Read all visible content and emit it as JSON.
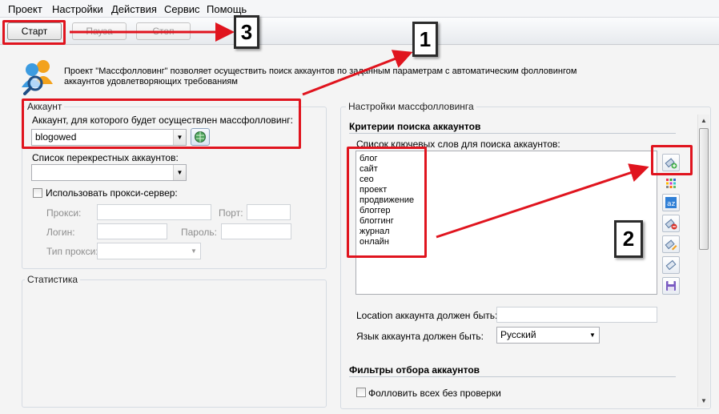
{
  "menu": [
    "Проект",
    "Настройки",
    "Действия",
    "Сервис",
    "Помощь"
  ],
  "toolbar": {
    "start": "Старт",
    "pause": "Пауза",
    "stop": "Стоп"
  },
  "header": {
    "icon": "users-search-icon",
    "description_line1": "Проект \"Массфолловинг\" позволяет осуществить поиск аккаунтов по заданным параметрам с автоматическим фолловингом",
    "description_line2": "аккаунтов удовлетворяющих требованиям"
  },
  "account": {
    "group_title": "Аккаунт",
    "account_label": "Аккаунт, для которого будет осуществлен массфолловинг:",
    "account_value": "blogowed",
    "cross_label": "Список перекрестных аккаунтов:",
    "cross_value": "",
    "proxy_checkbox_label": "Использовать прокси-сервер:",
    "proxy_label": "Прокси:",
    "port_label": "Порт:",
    "login_label": "Логин:",
    "password_label": "Пароль:",
    "proxy_type_label": "Тип прокси:"
  },
  "stats": {
    "group_title": "Статистика"
  },
  "settings": {
    "group_title": "Настройки массфолловинга",
    "criteria_title": "Критерии поиска аккаунтов",
    "keywords_label": "Список ключевых слов для поиска аккаунтов:",
    "keywords": [
      "блог",
      "сайт",
      "сео",
      "проект",
      "продвижение",
      "блоггер",
      "блоггинг",
      "журнал",
      "онлайн"
    ],
    "location_label": "Location аккаунта должен быть:",
    "location_value": "",
    "language_label": "Язык аккаунта должен быть:",
    "language_value": "Русский",
    "filters_title": "Фильтры отбора аккаунтов",
    "follow_all_label": "Фолловить всех без проверки"
  },
  "side_buttons": [
    "add-keyword-icon",
    "grid-icon",
    "shuffle-icon",
    "delete-keyword-icon",
    "edit-keyword-icon",
    "clear-keyword-icon",
    "save-icon"
  ],
  "annotations": {
    "n1": "1",
    "n2": "2",
    "n3": "3"
  },
  "colors": {
    "annotation_red": "#e0141e",
    "accent_blue": "#1e5aa8"
  }
}
